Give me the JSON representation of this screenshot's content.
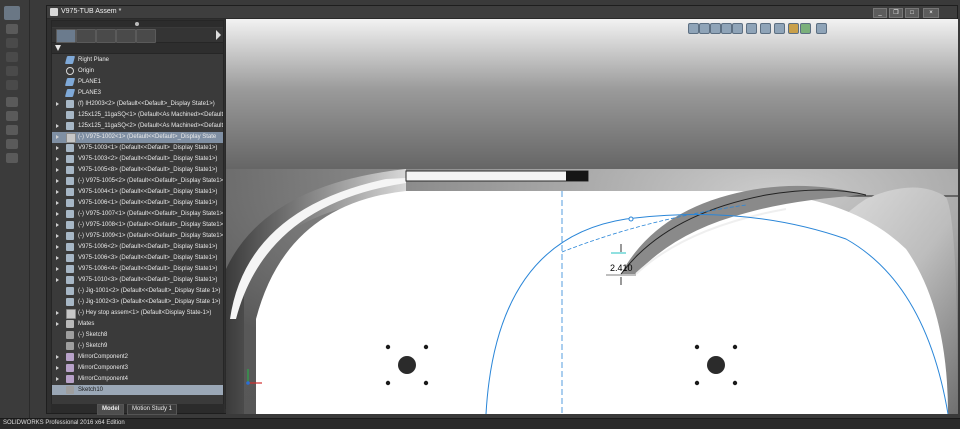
{
  "window": {
    "title": "V975-TUB Assem *",
    "controls": [
      "minimize",
      "restore",
      "close"
    ]
  },
  "status_bar": {
    "text": "SOLIDWORKS Professional 2016 x64 Edition"
  },
  "feature_manager": {
    "tabs": [
      "feature-manager",
      "property-manager",
      "configuration-manager",
      "dimxpert-manager",
      "display-manager"
    ],
    "tree": [
      {
        "label": "Right Plane",
        "icon": "plane-icon",
        "expandable": false
      },
      {
        "label": "Origin",
        "icon": "origin-icon",
        "expandable": false
      },
      {
        "label": "PLANE1",
        "icon": "plane-icon",
        "expandable": false
      },
      {
        "label": "PLANE3",
        "icon": "plane-icon",
        "expandable": false
      },
      {
        "label": "(f) IH2003<2> (Default<<Default>_Display State1>)",
        "icon": "part-icon",
        "expandable": true
      },
      {
        "label": "125x125_11gaSQ<1> (Default<As Machined><Default",
        "icon": "part-icon",
        "expandable": false
      },
      {
        "label": "125x125_11gaSQ<2> (Default<As Machined><Default",
        "icon": "part-icon",
        "expandable": true
      },
      {
        "label": "(-) V975-1002<1> (Default<<Default>_Display State",
        "icon": "assembly-icon",
        "expandable": true,
        "highlighted": true
      },
      {
        "label": "V975-1003<1> (Default<<Default>_Display State1>)",
        "icon": "part-icon",
        "expandable": true
      },
      {
        "label": "V975-1003<2> (Default<<Default>_Display State1>)",
        "icon": "part-icon",
        "expandable": true
      },
      {
        "label": "V975-1005<8> (Default<<Default>_Display State1>)",
        "icon": "part-icon",
        "expandable": true
      },
      {
        "label": "(-) V975-1005<2> (Default<<Default>_Display State1>)",
        "icon": "part-icon",
        "expandable": true
      },
      {
        "label": "V975-1004<1> (Default<<Default>_Display State1>)",
        "icon": "part-icon",
        "expandable": true
      },
      {
        "label": "V975-1006<1> (Default<<Default>_Display State1>)",
        "icon": "part-icon",
        "expandable": true
      },
      {
        "label": "(-) V975-1007<1> (Default<<Default>_Display State1>)",
        "icon": "part-icon",
        "expandable": true
      },
      {
        "label": "(-) V975-1008<1> (Default<<Default>_Display State1>)",
        "icon": "part-icon",
        "expandable": true
      },
      {
        "label": "(-) V975-1009<1> (Default<<Default>_Display State1>)",
        "icon": "part-icon",
        "expandable": true
      },
      {
        "label": "V975-1006<2> (Default<<Default>_Display State1>)",
        "icon": "part-icon",
        "expandable": true
      },
      {
        "label": "V975-1006<3> (Default<<Default>_Display State1>)",
        "icon": "part-icon",
        "expandable": true
      },
      {
        "label": "V975-1006<4> (Default<<Default>_Display State1>)",
        "icon": "part-icon",
        "expandable": true
      },
      {
        "label": "V975-1010<3> (Default<<Default>_Display State1>)",
        "icon": "part-icon",
        "expandable": true
      },
      {
        "label": "(-) Jig-1001<2> (Default<<Default>_Display State 1>)",
        "icon": "part-icon",
        "expandable": false
      },
      {
        "label": "(-) Jig-1002<3> (Default<<Default>_Display State 1>)",
        "icon": "part-icon",
        "expandable": false
      },
      {
        "label": "(-) Hey stop assem<1> (Default<Display State-1>)",
        "icon": "assembly-icon",
        "expandable": true
      },
      {
        "label": "Mates",
        "icon": "mates-icon",
        "expandable": true
      },
      {
        "label": "(-) Sketch8",
        "icon": "sketch-icon",
        "expandable": false
      },
      {
        "label": "(-) Sketch9",
        "icon": "sketch-icon",
        "expandable": false
      },
      {
        "label": "MirrorComponent2",
        "icon": "mirror-icon",
        "expandable": true
      },
      {
        "label": "MirrorComponent3",
        "icon": "mirror-icon",
        "expandable": true
      },
      {
        "label": "MirrorComponent4",
        "icon": "mirror-icon",
        "expandable": true
      },
      {
        "label": "Sketch10",
        "icon": "sketch-icon",
        "expandable": false,
        "selected": true
      }
    ]
  },
  "bottom_tabs": [
    "Model",
    "Motion Study 1"
  ],
  "viewport": {
    "dimension_value": "2.410",
    "heads_up_toolbar": [
      "zoom-to-fit-icon",
      "zoom-area-icon",
      "previous-view-icon",
      "section-view-icon",
      "dynamic-annotation-icon",
      "view-orientation-icon",
      "display-style-icon",
      "hide-show-icon",
      "edit-appearance-icon",
      "apply-scene-icon",
      "view-settings-icon"
    ]
  },
  "colors": {
    "sketch_line": "#2a86d8",
    "background": "#3a3a3a",
    "selection": "#9aa7b6"
  }
}
